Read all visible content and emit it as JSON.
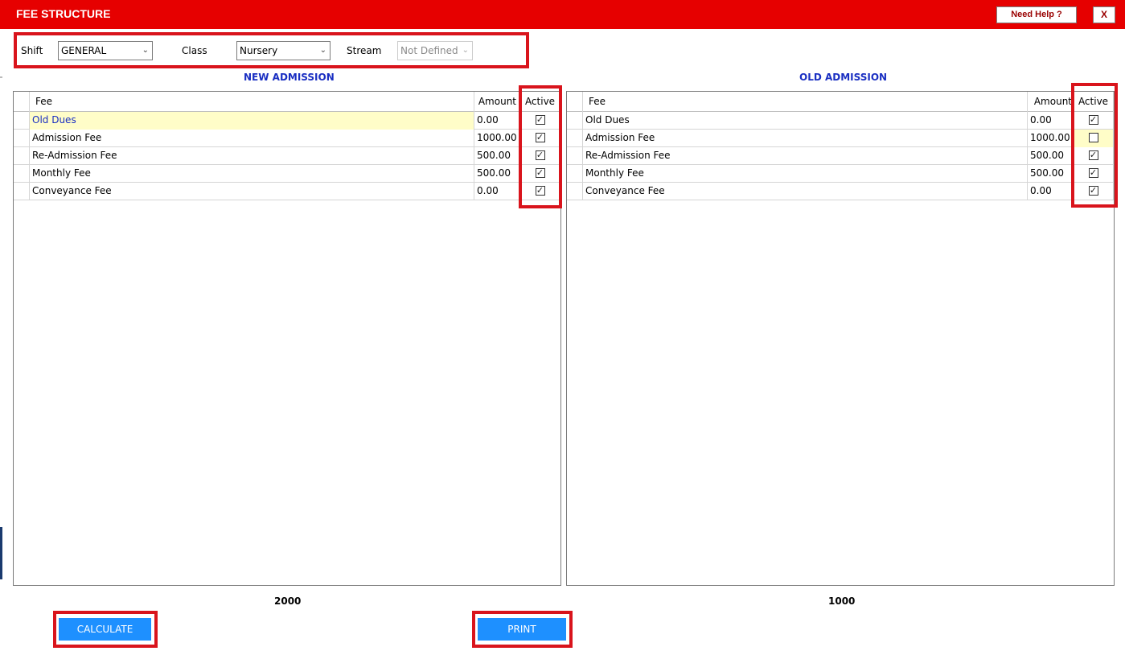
{
  "window": {
    "title": "FEE STRUCTURE",
    "help_label": "Need Help ?",
    "close_label": "X"
  },
  "filters": {
    "shift_label": "Shift",
    "shift_value": "GENERAL",
    "class_label": "Class",
    "class_value": "Nursery",
    "stream_label": "Stream",
    "stream_value": "Not Defined"
  },
  "new_admission": {
    "title": "NEW ADMISSION",
    "columns": [
      "Fee",
      "Amount",
      "Active"
    ],
    "rows": [
      {
        "fee": "Old Dues",
        "amount": "0.00",
        "active": true
      },
      {
        "fee": "Admission Fee",
        "amount": "1000.00",
        "active": true
      },
      {
        "fee": "Re-Admission Fee",
        "amount": "500.00",
        "active": true
      },
      {
        "fee": "Monthly Fee",
        "amount": "500.00",
        "active": true
      },
      {
        "fee": "Conveyance Fee",
        "amount": "0.00",
        "active": true
      }
    ],
    "total": "2000"
  },
  "old_admission": {
    "title": "OLD ADMISSION",
    "columns": [
      "Fee",
      "Amount",
      "Active"
    ],
    "rows": [
      {
        "fee": "Old Dues",
        "amount": "0.00",
        "active": true
      },
      {
        "fee": "Admission Fee",
        "amount": "1000.00",
        "active": false
      },
      {
        "fee": "Re-Admission Fee",
        "amount": "500.00",
        "active": true
      },
      {
        "fee": "Monthly Fee",
        "amount": "500.00",
        "active": true
      },
      {
        "fee": "Conveyance Fee",
        "amount": "0.00",
        "active": true
      }
    ],
    "total": "1000"
  },
  "actions": {
    "calculate_label": "CALCULATE",
    "print_label": "PRINT"
  },
  "colors": {
    "titlebar": "#e60000",
    "highlight_box": "#d9141c",
    "button": "#1e90ff",
    "grid_title": "#1a2fc2",
    "selected_cell": "#fffdc8"
  }
}
